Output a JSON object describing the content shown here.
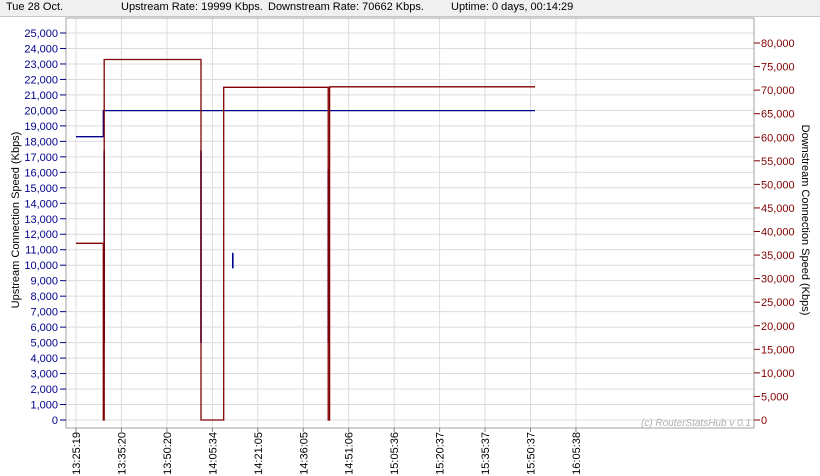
{
  "status": {
    "date": "Tue 28 Oct.",
    "upstream": "Upstream Rate: 19999 Kbps.",
    "downstream": "Downstream Rate: 70662 Kbps.",
    "uptime": "Uptime: 0 days, 00:14:29"
  },
  "watermark": "(c) RouterStatsHub v 0.1",
  "colors": {
    "upstream": "#00008b",
    "downstream": "#800000",
    "grid": "#dcdcdc"
  },
  "chart_data": {
    "type": "line",
    "title": "",
    "xlabel": "",
    "ylabel_left": "Upstream Connection Speed (Kbps)",
    "ylabel_right": "Downstream Connection Speed (Kbps)",
    "grid": true,
    "x_ticks": [
      "13:25:19",
      "13:35:20",
      "13:50:20",
      "14:05:34",
      "14:21:05",
      "14:36:05",
      "14:51:06",
      "15:05:36",
      "15:20:37",
      "15:35:37",
      "15:50:37",
      "16:05:38"
    ],
    "y_left_range": [
      0,
      25000
    ],
    "y_left_ticks": [
      "0",
      "1,000",
      "2,000",
      "3,000",
      "4,000",
      "5,000",
      "6,000",
      "7,000",
      "8,000",
      "9,000",
      "10,000",
      "11,000",
      "12,000",
      "13,000",
      "14,000",
      "15,000",
      "16,000",
      "17,000",
      "18,000",
      "19,000",
      "20,000",
      "21,000",
      "22,000",
      "23,000",
      "24,000",
      "25,000"
    ],
    "y_right_range": [
      0,
      80000
    ],
    "y_right_ticks": [
      "0",
      "5,000",
      "10,000",
      "15,000",
      "20,000",
      "25,000",
      "30,000",
      "35,000",
      "40,000",
      "45,000",
      "50,000",
      "55,000",
      "60,000",
      "65,000",
      "70,000",
      "75,000",
      "80,000"
    ],
    "series": [
      {
        "name": "Upstream",
        "axis": "left",
        "points": [
          [
            0,
            18300
          ],
          [
            0.6,
            18300
          ],
          [
            0.6,
            19990
          ],
          [
            2.75,
            19990
          ],
          [
            3.45,
            19990
          ],
          [
            3.45,
            19990
          ],
          [
            7.8,
            19990
          ],
          [
            10.1,
            19990
          ]
        ],
        "spikes": [
          {
            "x": 0.62,
            "low": 5000,
            "high": 17400
          },
          {
            "x": 2.75,
            "low": 5000,
            "high": 17400
          },
          {
            "x": 3.45,
            "low": 9800,
            "high": 10800
          },
          {
            "x": 5.55,
            "low": 5000,
            "high": 16200
          }
        ]
      },
      {
        "name": "Downstream",
        "axis": "right",
        "points": [
          [
            0,
            37500
          ],
          [
            0.6,
            37500
          ],
          [
            0.6,
            0
          ],
          [
            0.62,
            0
          ],
          [
            0.62,
            76500
          ],
          [
            2.75,
            76500
          ],
          [
            2.75,
            0
          ],
          [
            3.25,
            0
          ],
          [
            3.25,
            70600
          ],
          [
            5.55,
            70600
          ],
          [
            5.55,
            0
          ],
          [
            5.58,
            0
          ],
          [
            5.58,
            70700
          ],
          [
            10.1,
            70700
          ]
        ]
      }
    ]
  }
}
